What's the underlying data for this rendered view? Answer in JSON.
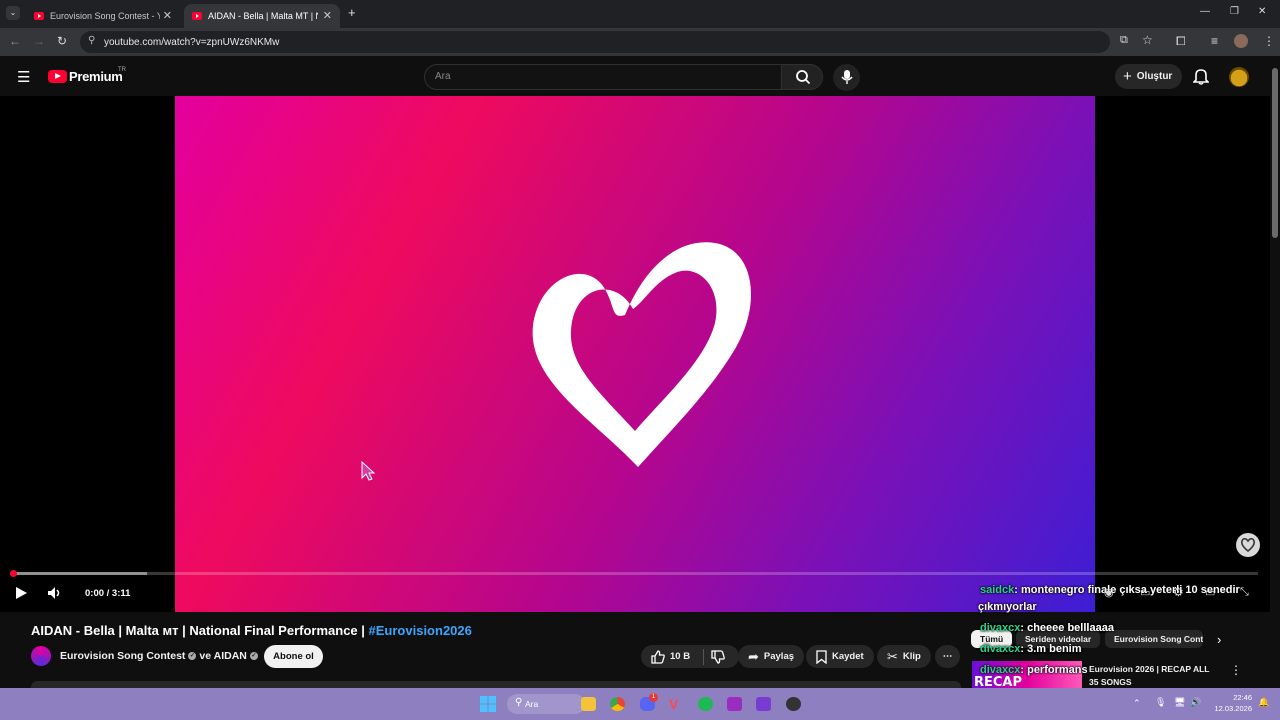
{
  "browser": {
    "tabs": [
      {
        "title": "Eurovision Song Contest - YouTube"
      },
      {
        "title": "AIDAN - Bella | Malta MT | Natio"
      }
    ],
    "url": "youtube.com/watch?v=zpnUWz6NKMw"
  },
  "masthead": {
    "logo_text": "Premium",
    "region": "TR",
    "search_placeholder": "Ara",
    "create_label": "Oluştur"
  },
  "player": {
    "time": "0:00 / 3:11",
    "progress_fraction": 0.0,
    "chat": [
      {
        "user": "saidck",
        "text": ": montenegro finale çıksa yeterli 10 senedir"
      },
      {
        "user": "",
        "text": "çıkmıyorlar"
      },
      {
        "user": "divaxcx",
        "text": ": cheeee belllaaaa"
      },
      {
        "user": "divaxcx",
        "text": ": 3.m benim"
      },
      {
        "user": "divaxcx",
        "text": ": performans"
      }
    ]
  },
  "video_info": {
    "title_main": "AIDAN - Bella | Malta ᴍᴛ | National Final Performance | ",
    "title_tag": "#Eurovision2026",
    "channel": "Eurovision Song Contest",
    "channel_joiner": "ve AIDAN",
    "subscribe_label": "Abone ol",
    "likes": "10 B",
    "share_label": "Paylaş",
    "save_label": "Kaydet",
    "clip_label": "Klip"
  },
  "sidebar": {
    "chips": [
      "Tümü",
      "Seriden videolar",
      "Eurovision Song Contest"
    ],
    "rec_thumb_text": "RECAP",
    "rec_title": "Eurovision 2026 | RECAP ALL 35 SONGS"
  },
  "taskbar": {
    "search_label": "Ara",
    "time": "22:46",
    "date": "12.03.2026",
    "discord_badge": "1"
  },
  "colors": {
    "youtube_red": "#ff0033",
    "chat_user": "#28d28c",
    "hashtag_link": "#3ea6ff",
    "taskbar": "#8d7fc0"
  }
}
